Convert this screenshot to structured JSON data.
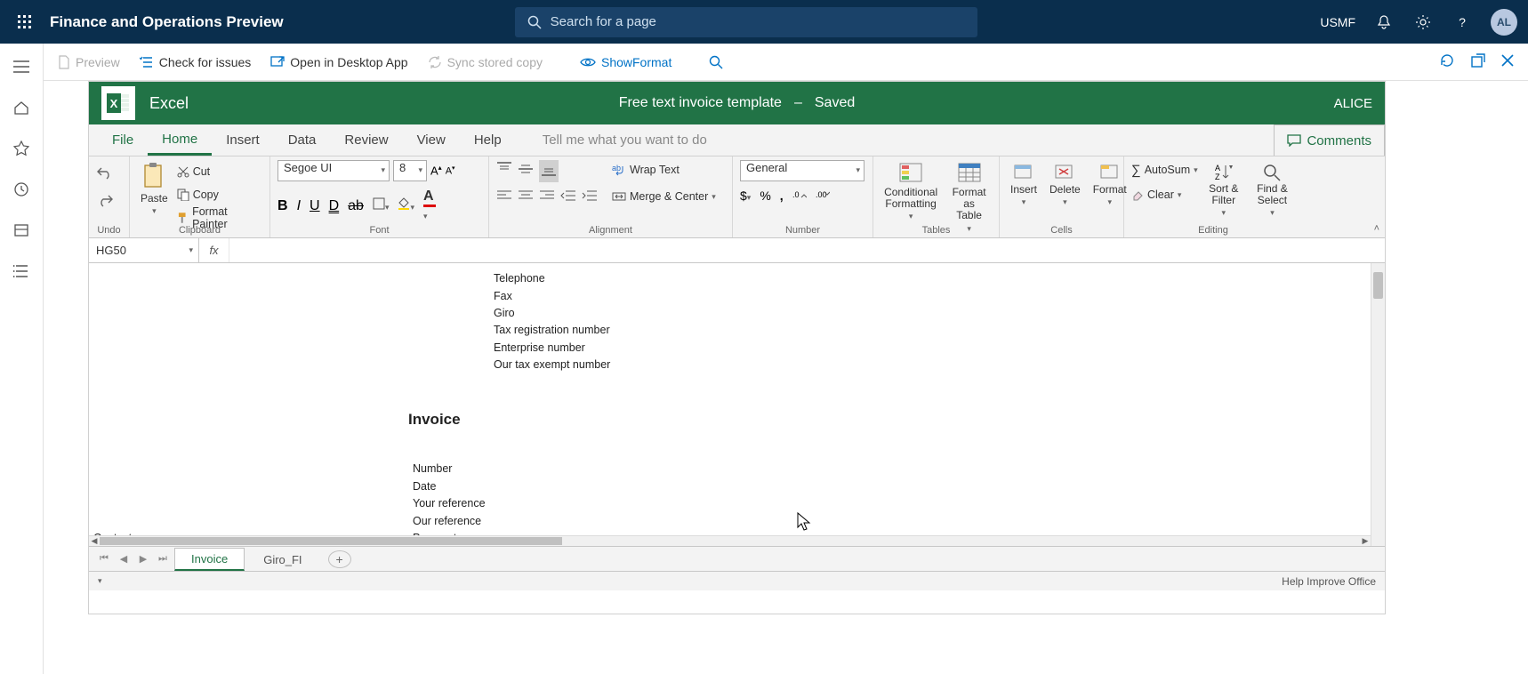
{
  "topbar": {
    "title": "Finance and Operations Preview",
    "search_placeholder": "Search for a page",
    "company": "USMF",
    "avatar": "AL"
  },
  "actionbar": {
    "preview": "Preview",
    "check_issues": "Check for issues",
    "open_desktop": "Open in Desktop App",
    "sync_stored": "Sync stored copy",
    "show_format": "ShowFormat"
  },
  "excel": {
    "brand": "Excel",
    "doc_title": "Free text invoice template",
    "dash": "–",
    "saved": "Saved",
    "user": "ALICE",
    "tabs": {
      "file": "File",
      "home": "Home",
      "insert": "Insert",
      "data": "Data",
      "review": "Review",
      "view": "View",
      "help": "Help",
      "tellme": "Tell me what you want to do",
      "comments": "Comments"
    },
    "ribbon": {
      "undo_group": "Undo",
      "clipboard_group": "Clipboard",
      "paste": "Paste",
      "cut": "Cut",
      "copy": "Copy",
      "format_painter": "Format Painter",
      "font_group": "Font",
      "font_name": "Segoe UI",
      "font_size": "8",
      "alignment_group": "Alignment",
      "wrap_text": "Wrap Text",
      "merge_center": "Merge & Center",
      "number_group": "Number",
      "number_format": "General",
      "tables_group": "Tables",
      "cond_format": "Conditional Formatting",
      "format_table": "Format as Table",
      "cells_group": "Cells",
      "insert": "Insert",
      "delete": "Delete",
      "format": "Format",
      "editing_group": "Editing",
      "autosum": "AutoSum",
      "clear": "Clear",
      "sort_filter": "Sort & Filter",
      "find_select": "Find & Select"
    },
    "name_box": "HG50",
    "sheet_tabs": {
      "invoice": "Invoice",
      "giro": "Giro_FI"
    },
    "status_right": "Help Improve Office"
  },
  "sheet": {
    "telephone": "Telephone",
    "fax": "Fax",
    "giro": "Giro",
    "tax_reg": "Tax registration number",
    "enterprise": "Enterprise number",
    "tax_exempt": "Our tax exempt number",
    "invoice_heading": "Invoice",
    "number": "Number",
    "date": "Date",
    "your_ref": "Your reference",
    "our_ref": "Our reference",
    "payment": "Payment",
    "contact": "Contact"
  }
}
